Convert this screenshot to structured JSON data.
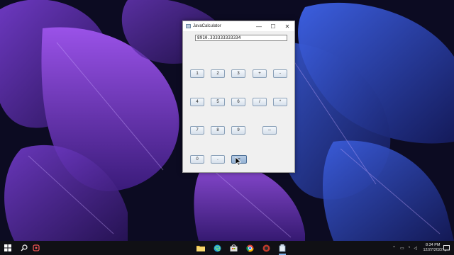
{
  "window": {
    "title": "JavaCalculator",
    "minimize_label": "—",
    "maximize_label": "☐",
    "close_label": "✕"
  },
  "calculator": {
    "display_value": "8910.333333333334",
    "keys": {
      "k1": "1",
      "k2": "2",
      "k3": "3",
      "plus": "+",
      "minus": "-",
      "k4": "4",
      "k5": "5",
      "k6": "6",
      "divide": "/",
      "multiply": "*",
      "k7": "7",
      "k8": "8",
      "k9": "9",
      "clear": "--",
      "k0": "0",
      "dot": ".",
      "equals": "="
    },
    "pressed_key": "equals"
  },
  "taskbar": {
    "icons": [
      "start-icon",
      "search-icon",
      "app-icon",
      "file-explorer-icon",
      "edge-icon",
      "store-icon",
      "chrome-icon",
      "app-icon-2",
      "java-icon"
    ],
    "clock_time": "8:34 PM",
    "clock_date": "12/27/2022",
    "accent_color": "#7fb3e8"
  }
}
